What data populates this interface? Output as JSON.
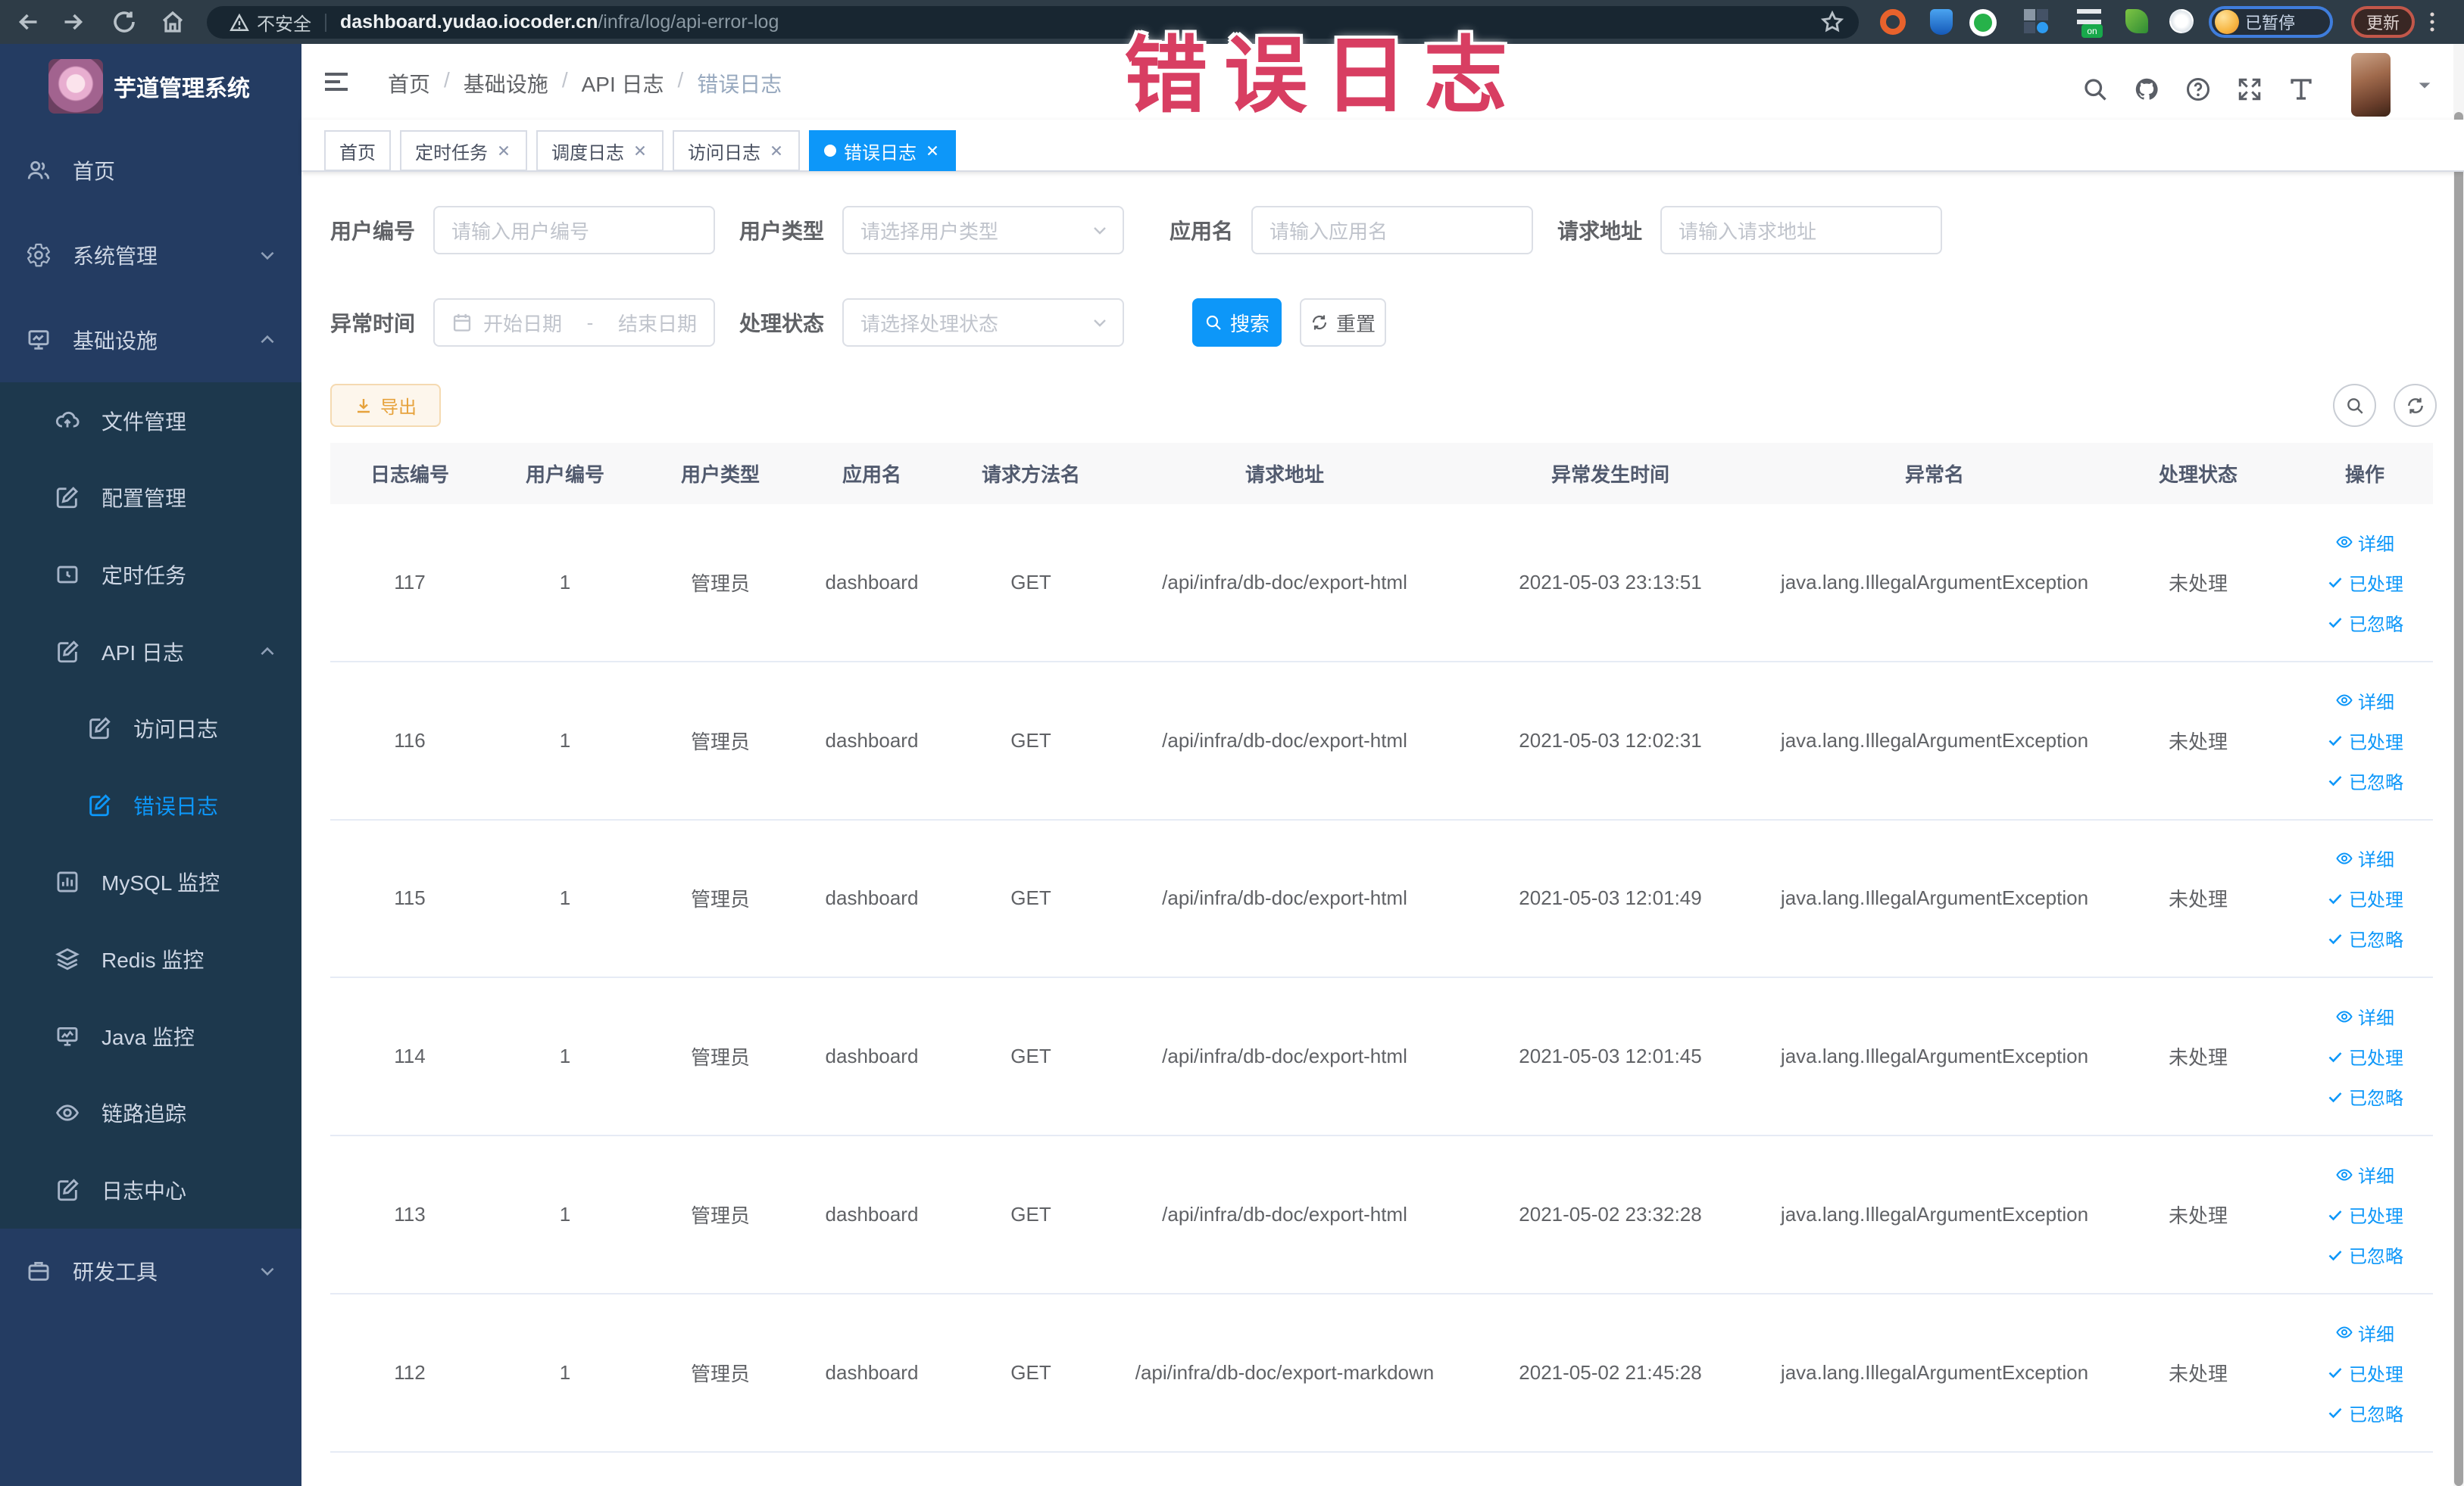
{
  "browser": {
    "security_label": "不安全",
    "url_domain": "dashboard.yudao.iocoder.cn",
    "url_path": "/infra/log/api-error-log",
    "profile_chip": "已暂停",
    "update_button": "更新"
  },
  "watermark": "错误日志",
  "sidebar": {
    "title": "芋道管理系统",
    "menu": [
      {
        "name": "home",
        "label": "首页",
        "icon": "user",
        "level": 0
      },
      {
        "name": "system-management",
        "label": "系统管理",
        "icon": "gear",
        "level": 0,
        "chevron": "down"
      },
      {
        "name": "infrastructure",
        "label": "基础设施",
        "icon": "infra",
        "level": 0,
        "chevron": "up"
      },
      {
        "name": "file-management",
        "label": "文件管理",
        "icon": "cloud",
        "level": 1,
        "sub": true
      },
      {
        "name": "config-management",
        "label": "配置管理",
        "icon": "edit",
        "level": 1,
        "sub": true
      },
      {
        "name": "scheduled-tasks",
        "label": "定时任务",
        "icon": "timer",
        "level": 1,
        "sub": true
      },
      {
        "name": "api-log",
        "label": "API 日志",
        "icon": "doc",
        "level": 1,
        "chevron": "up",
        "sub": true
      },
      {
        "name": "access-log",
        "label": "访问日志",
        "icon": "doc",
        "level": 2,
        "sub": true
      },
      {
        "name": "error-log",
        "label": "错误日志",
        "icon": "doc",
        "level": 2,
        "active": true,
        "sub": true
      },
      {
        "name": "mysql-monitor",
        "label": "MySQL 监控",
        "icon": "chart",
        "level": 1,
        "sub": true
      },
      {
        "name": "redis-monitor",
        "label": "Redis 监控",
        "icon": "layers",
        "level": 1,
        "sub": true
      },
      {
        "name": "java-monitor",
        "label": "Java 监控",
        "icon": "monitor",
        "level": 1,
        "sub": true
      },
      {
        "name": "trace",
        "label": "链路追踪",
        "icon": "eye",
        "level": 1,
        "sub": true
      },
      {
        "name": "log-center",
        "label": "日志中心",
        "icon": "doc",
        "level": 1,
        "sub": true
      },
      {
        "name": "dev-tools",
        "label": "研发工具",
        "icon": "tool",
        "level": 0,
        "chevron": "down"
      }
    ]
  },
  "navbar": {
    "breadcrumb": [
      "首页",
      "基础设施",
      "API 日志",
      "错误日志"
    ]
  },
  "tabs": [
    {
      "name": "home",
      "label": "首页"
    },
    {
      "name": "scheduled-tasks",
      "label": "定时任务",
      "closable": true
    },
    {
      "name": "schedule-log",
      "label": "调度日志",
      "closable": true
    },
    {
      "name": "access-log",
      "label": "访问日志",
      "closable": true
    },
    {
      "name": "error-log",
      "label": "错误日志",
      "closable": true,
      "active": true
    }
  ],
  "filters": {
    "user_id": {
      "label": "用户编号",
      "placeholder": "请输入用户编号"
    },
    "user_type": {
      "label": "用户类型",
      "placeholder": "请选择用户类型"
    },
    "app_name": {
      "label": "应用名",
      "placeholder": "请输入应用名"
    },
    "request_url": {
      "label": "请求地址",
      "placeholder": "请输入请求地址"
    },
    "exception_time": {
      "label": "异常时间",
      "start_placeholder": "开始日期",
      "separator": "-",
      "end_placeholder": "结束日期"
    },
    "process_status": {
      "label": "处理状态",
      "placeholder": "请选择处理状态"
    },
    "search_label": "搜索",
    "reset_label": "重置"
  },
  "toolbar": {
    "export_label": "导出"
  },
  "table": {
    "columns": [
      "日志编号",
      "用户编号",
      "用户类型",
      "应用名",
      "请求方法名",
      "请求地址",
      "异常发生时间",
      "异常名",
      "处理状态",
      "操作"
    ],
    "actions": [
      "详细",
      "已处理",
      "已忽略"
    ],
    "rows": [
      [
        "117",
        "1",
        "管理员",
        "dashboard",
        "GET",
        "/api/infra/db-doc/export-html",
        "2021-05-03 23:13:51",
        "java.lang.IllegalArgumentException",
        "未处理"
      ],
      [
        "116",
        "1",
        "管理员",
        "dashboard",
        "GET",
        "/api/infra/db-doc/export-html",
        "2021-05-03 12:02:31",
        "java.lang.IllegalArgumentException",
        "未处理"
      ],
      [
        "115",
        "1",
        "管理员",
        "dashboard",
        "GET",
        "/api/infra/db-doc/export-html",
        "2021-05-03 12:01:49",
        "java.lang.IllegalArgumentException",
        "未处理"
      ],
      [
        "114",
        "1",
        "管理员",
        "dashboard",
        "GET",
        "/api/infra/db-doc/export-html",
        "2021-05-03 12:01:45",
        "java.lang.IllegalArgumentException",
        "未处理"
      ],
      [
        "113",
        "1",
        "管理员",
        "dashboard",
        "GET",
        "/api/infra/db-doc/export-html",
        "2021-05-02 23:32:28",
        "java.lang.IllegalArgumentException",
        "未处理"
      ],
      [
        "112",
        "1",
        "管理员",
        "dashboard",
        "GET",
        "/api/infra/db-doc/export-markdown",
        "2021-05-02 21:45:28",
        "java.lang.IllegalArgumentException",
        "未处理"
      ]
    ]
  },
  "colors": {
    "accent": "#0d97f9",
    "sidebar_bg": "#243c62",
    "submenu_bg": "#1d384d",
    "watermark": "#d83e62",
    "warning": "#e6a23c"
  }
}
